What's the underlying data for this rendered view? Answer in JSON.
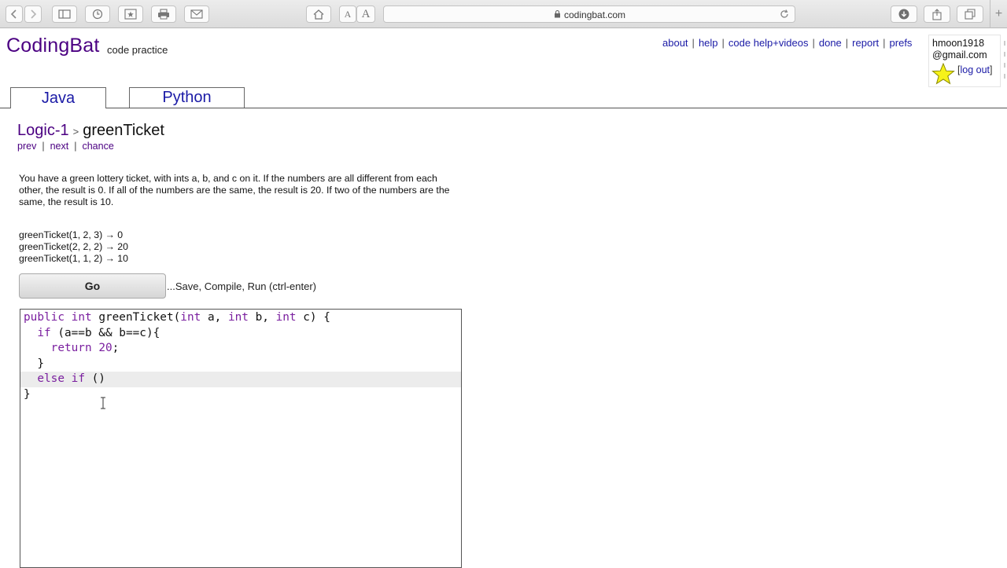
{
  "browser": {
    "url": "codingbat.com",
    "font_small": "A",
    "font_large": "A",
    "new_tab": "+"
  },
  "site": {
    "logo": "CodingBat",
    "tagline": "code practice",
    "links": [
      "about",
      "help",
      "code help+videos",
      "done",
      "report",
      "prefs"
    ],
    "user_line1": "hmoon1918",
    "user_line2": "@gmail.com",
    "logout_open": "[",
    "logout": "log out",
    "logout_close": "]"
  },
  "tabs": [
    {
      "label": "Java",
      "active": true
    },
    {
      "label": "Python",
      "active": false
    }
  ],
  "problem": {
    "category": "Logic-1",
    "crumb_arrow": ">",
    "title": "greenTicket",
    "nav": [
      "prev",
      "next",
      "chance"
    ],
    "description": "You have a green lottery ticket, with ints a, b, and c on it. If the numbers are all different from each other, the result is 0. If all of the numbers are the same, the result is 20. If two of the numbers are the same, the result is 10.",
    "examples": [
      "greenTicket(1, 2, 3) → 0",
      "greenTicket(2, 2, 2) → 20",
      "greenTicket(1, 1, 2) → 10"
    ]
  },
  "actions": {
    "go_label": "Go",
    "go_hint": "...Save, Compile, Run (ctrl-enter)"
  },
  "editor": {
    "lines": [
      {
        "k1": "public",
        "s1": " ",
        "k2": "int",
        "rest": " greenTicket(",
        "k3": "int",
        "r2": " a, ",
        "k4": "int",
        "r3": " b, ",
        "k5": "int",
        "r4": " c) {"
      },
      {
        "indent": "  ",
        "k1": "if",
        "rest": " (a==b && b==c){"
      },
      {
        "indent": "    ",
        "k1": "return",
        "s1": " ",
        "num": "20",
        "rest": ";"
      },
      {
        "text": "  }"
      },
      {
        "indent": "  ",
        "k1": "else",
        "s1": " ",
        "k2": "if",
        "rest": " ()"
      },
      {
        "text": "}"
      }
    ]
  },
  "colors": {
    "keyword": "#7a1f9f",
    "logo": "#4b0082",
    "link": "#1a1aa6"
  }
}
